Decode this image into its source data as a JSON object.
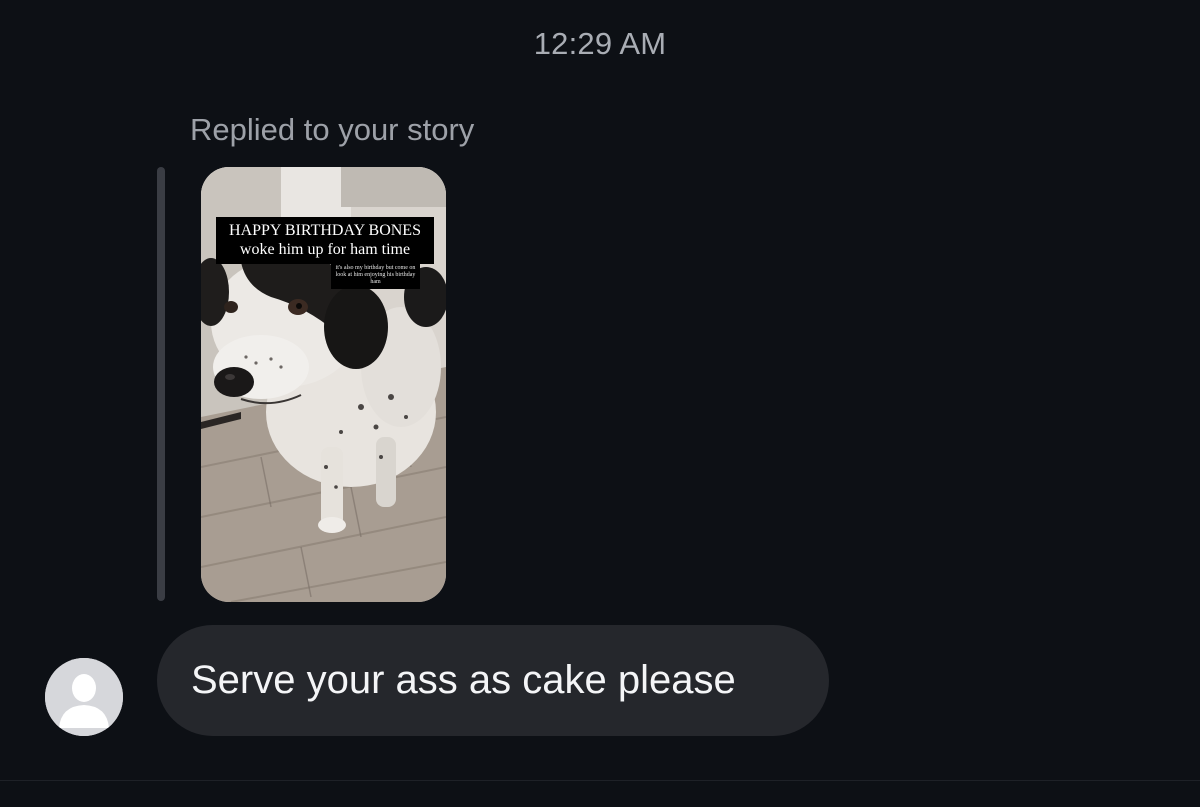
{
  "conversation": {
    "timestamp": "12:29 AM",
    "reply_label": "Replied to your story",
    "story": {
      "caption_title": "HAPPY BIRTHDAY BONES",
      "caption_subtitle": "woke him up for ham time",
      "caption_small": "it's also my birthday but come on look at him enjoying his birthday ham"
    },
    "message": {
      "text": "Serve your ass as cake please"
    },
    "avatar_icon": "default-user-icon"
  },
  "colors": {
    "background": "#0d1015",
    "bubble": "#25272c",
    "text_muted": "#9da1a8",
    "text_primary": "#f4f5f7"
  }
}
